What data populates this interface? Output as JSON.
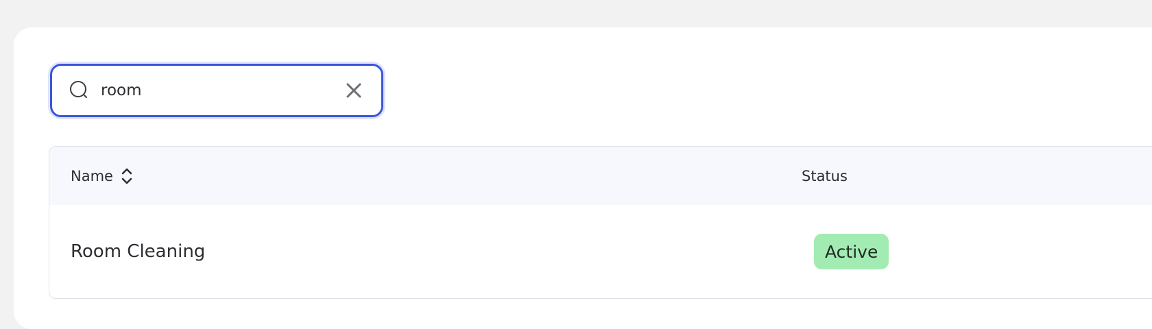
{
  "search": {
    "value": "room",
    "icon": "search-icon",
    "clear_icon": "close-icon",
    "focus_color": "#3a55d8"
  },
  "table": {
    "columns": [
      {
        "label": "Name",
        "sortable": true
      },
      {
        "label": "Status",
        "sortable": false
      }
    ],
    "rows": [
      {
        "name": "Room Cleaning",
        "status": "Active",
        "status_color": "#a2ecb3"
      }
    ]
  }
}
